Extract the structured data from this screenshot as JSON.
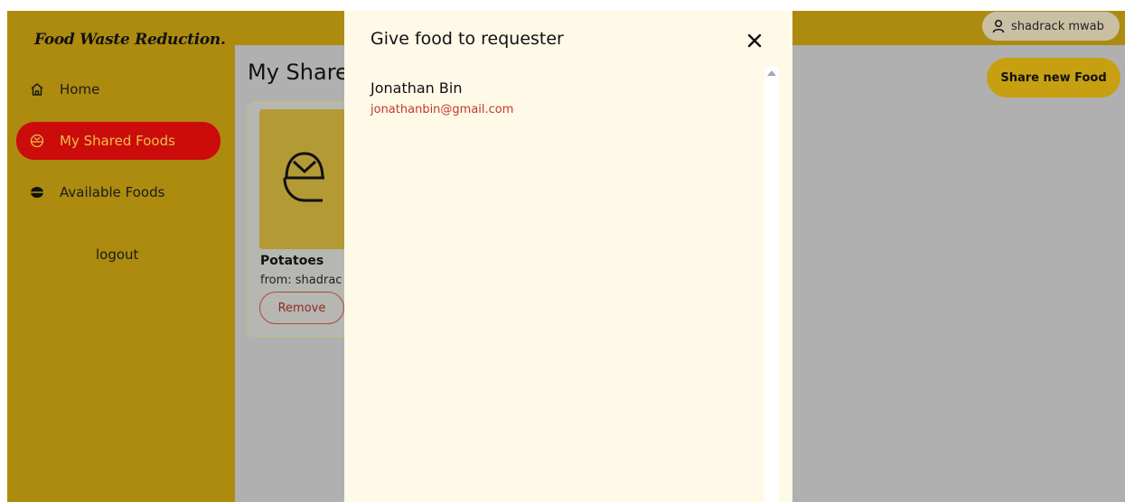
{
  "app": {
    "brand": "Food Waste Reduction."
  },
  "sidebar": {
    "items": [
      {
        "label": "Home",
        "icon": "home-icon"
      },
      {
        "label": "My Shared Foods",
        "icon": "bowl-icon",
        "active": true
      },
      {
        "label": "Available Foods",
        "icon": "food-icon"
      }
    ],
    "logout_label": "logout"
  },
  "header": {
    "user_name": "shadrack mwab",
    "user_icon": "user-icon"
  },
  "main": {
    "heading": "My Share",
    "share_button_label": "Share new Food",
    "card": {
      "name": "Potatoes",
      "from": "from: shadrac",
      "remove_label": "Remove"
    }
  },
  "modal": {
    "title": "Give food to requester",
    "close_icon": "close-icon",
    "requesters": [
      {
        "name": "Jonathan Bin",
        "email": "jonathanbin@gmail.com"
      }
    ]
  },
  "colors": {
    "sidebar": "#ad8b0f",
    "active_nav": "#cc0b0b",
    "modal_bg": "#fff9e8",
    "email": "#c0392b",
    "overlay": "#b0b0b0"
  }
}
